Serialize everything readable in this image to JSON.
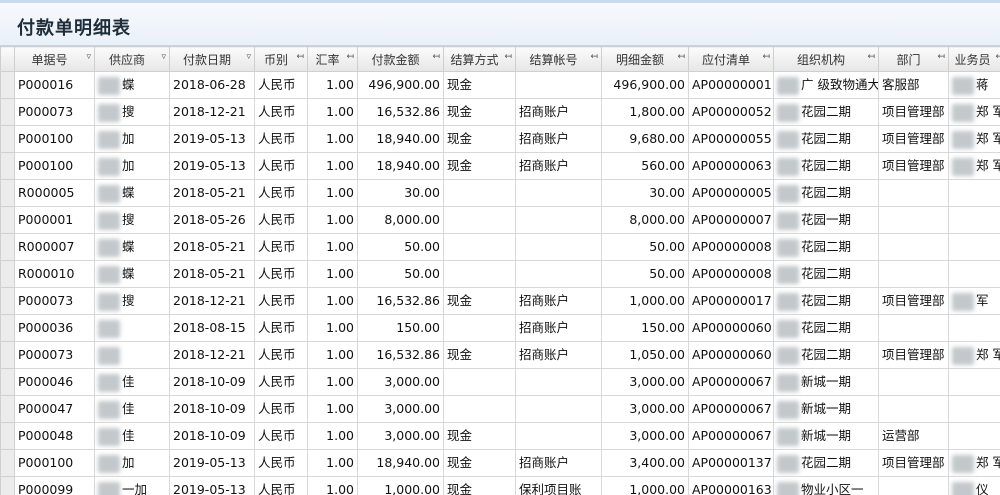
{
  "title": "付款单明细表",
  "columns": [
    {
      "key": "sel",
      "label": ""
    },
    {
      "key": "doc_no",
      "label": "单据号"
    },
    {
      "key": "supplier",
      "label": "供应商"
    },
    {
      "key": "pay_date",
      "label": "付款日期"
    },
    {
      "key": "currency",
      "label": "币别"
    },
    {
      "key": "rate",
      "label": "汇率"
    },
    {
      "key": "pay_amount",
      "label": "付款金额"
    },
    {
      "key": "settle_method",
      "label": "结算方式"
    },
    {
      "key": "settle_account",
      "label": "结算帐号"
    },
    {
      "key": "detail_amount",
      "label": "明细金额"
    },
    {
      "key": "payable_list",
      "label": "应付清单"
    },
    {
      "key": "org",
      "label": "组织机构"
    },
    {
      "key": "dept",
      "label": "部门"
    },
    {
      "key": "salesman",
      "label": "业务员"
    }
  ],
  "rows": [
    {
      "doc_no": "P000016",
      "supplier": "蝶",
      "pay_date": "2018-06-28",
      "currency": "人民币",
      "rate": "1.00",
      "pay_amount": "496,900.00",
      "settle_method": "现金",
      "settle_account": "",
      "detail_amount": "496,900.00",
      "payable_list": "AP00000001",
      "org": "广 级致物通大",
      "dept": "客服部",
      "salesman": "蒋"
    },
    {
      "doc_no": "P000073",
      "supplier": "搜",
      "pay_date": "2018-12-21",
      "currency": "人民币",
      "rate": "1.00",
      "pay_amount": "16,532.86",
      "settle_method": "现金",
      "settle_account": "招商账户",
      "detail_amount": "1,800.00",
      "payable_list": "AP00000052",
      "org": "花园二期",
      "dept": "项目管理部",
      "salesman": "郑 军"
    },
    {
      "doc_no": "P000100",
      "supplier": "加",
      "pay_date": "2019-05-13",
      "currency": "人民币",
      "rate": "1.00",
      "pay_amount": "18,940.00",
      "settle_method": "现金",
      "settle_account": "招商账户",
      "detail_amount": "9,680.00",
      "payable_list": "AP00000055",
      "org": "花园二期",
      "dept": "项目管理部",
      "salesman": "郑 军"
    },
    {
      "doc_no": "P000100",
      "supplier": "加",
      "pay_date": "2019-05-13",
      "currency": "人民币",
      "rate": "1.00",
      "pay_amount": "18,940.00",
      "settle_method": "现金",
      "settle_account": "招商账户",
      "detail_amount": "560.00",
      "payable_list": "AP00000063",
      "org": "花园二期",
      "dept": "项目管理部",
      "salesman": "郑 军"
    },
    {
      "doc_no": "R000005",
      "supplier": "蝶",
      "pay_date": "2018-05-21",
      "currency": "人民币",
      "rate": "1.00",
      "pay_amount": "30.00",
      "settle_method": "",
      "settle_account": "",
      "detail_amount": "30.00",
      "payable_list": "AP00000005",
      "org": "花园二期",
      "dept": "",
      "salesman": ""
    },
    {
      "doc_no": "P000001",
      "supplier": "搜",
      "pay_date": "2018-05-26",
      "currency": "人民币",
      "rate": "1.00",
      "pay_amount": "8,000.00",
      "settle_method": "",
      "settle_account": "",
      "detail_amount": "8,000.00",
      "payable_list": "AP00000007",
      "org": "花园一期",
      "dept": "",
      "salesman": ""
    },
    {
      "doc_no": "R000007",
      "supplier": "蝶",
      "pay_date": "2018-05-21",
      "currency": "人民币",
      "rate": "1.00",
      "pay_amount": "50.00",
      "settle_method": "",
      "settle_account": "",
      "detail_amount": "50.00",
      "payable_list": "AP00000008",
      "org": "花园二期",
      "dept": "",
      "salesman": ""
    },
    {
      "doc_no": "R000010",
      "supplier": "蝶",
      "pay_date": "2018-05-21",
      "currency": "人民币",
      "rate": "1.00",
      "pay_amount": "50.00",
      "settle_method": "",
      "settle_account": "",
      "detail_amount": "50.00",
      "payable_list": "AP00000008",
      "org": "花园二期",
      "dept": "",
      "salesman": ""
    },
    {
      "doc_no": "P000073",
      "supplier": "搜",
      "pay_date": "2018-12-21",
      "currency": "人民币",
      "rate": "1.00",
      "pay_amount": "16,532.86",
      "settle_method": "现金",
      "settle_account": "招商账户",
      "detail_amount": "1,000.00",
      "payable_list": "AP00000017",
      "org": "花园二期",
      "dept": "项目管理部",
      "salesman": "军"
    },
    {
      "doc_no": "P000036",
      "supplier": "",
      "pay_date": "2018-08-15",
      "currency": "人民币",
      "rate": "1.00",
      "pay_amount": "150.00",
      "settle_method": "",
      "settle_account": "招商账户",
      "detail_amount": "150.00",
      "payable_list": "AP00000060",
      "org": "花园二期",
      "dept": "",
      "salesman": ""
    },
    {
      "doc_no": "P000073",
      "supplier": "",
      "pay_date": "2018-12-21",
      "currency": "人民币",
      "rate": "1.00",
      "pay_amount": "16,532.86",
      "settle_method": "现金",
      "settle_account": "招商账户",
      "detail_amount": "1,050.00",
      "payable_list": "AP00000060",
      "org": "花园二期",
      "dept": "项目管理部",
      "salesman": "郑 军"
    },
    {
      "doc_no": "P000046",
      "supplier": "佳",
      "pay_date": "2018-10-09",
      "currency": "人民币",
      "rate": "1.00",
      "pay_amount": "3,000.00",
      "settle_method": "",
      "settle_account": "",
      "detail_amount": "3,000.00",
      "payable_list": "AP00000067",
      "org": "新城一期",
      "dept": "",
      "salesman": ""
    },
    {
      "doc_no": "P000047",
      "supplier": "佳",
      "pay_date": "2018-10-09",
      "currency": "人民币",
      "rate": "1.00",
      "pay_amount": "3,000.00",
      "settle_method": "",
      "settle_account": "",
      "detail_amount": "3,000.00",
      "payable_list": "AP00000067",
      "org": "新城一期",
      "dept": "",
      "salesman": ""
    },
    {
      "doc_no": "P000048",
      "supplier": "佳",
      "pay_date": "2018-10-09",
      "currency": "人民币",
      "rate": "1.00",
      "pay_amount": "3,000.00",
      "settle_method": "现金",
      "settle_account": "",
      "detail_amount": "3,000.00",
      "payable_list": "AP00000067",
      "org": "新城一期",
      "dept": "运营部",
      "salesman": ""
    },
    {
      "doc_no": "P000100",
      "supplier": "加",
      "pay_date": "2019-05-13",
      "currency": "人民币",
      "rate": "1.00",
      "pay_amount": "18,940.00",
      "settle_method": "现金",
      "settle_account": "招商账户",
      "detail_amount": "3,400.00",
      "payable_list": "AP00000137",
      "org": "花园二期",
      "dept": "项目管理部",
      "salesman": "郑 军"
    },
    {
      "doc_no": "P000099",
      "supplier": "一加",
      "pay_date": "2019-05-13",
      "currency": "人民币",
      "rate": "1.00",
      "pay_amount": "1,000.00",
      "settle_method": "现金",
      "settle_account": "保利项目账",
      "detail_amount": "1,000.00",
      "payable_list": "AP00000163",
      "org": "物业小区一",
      "dept": "",
      "salesman": "仪"
    }
  ]
}
